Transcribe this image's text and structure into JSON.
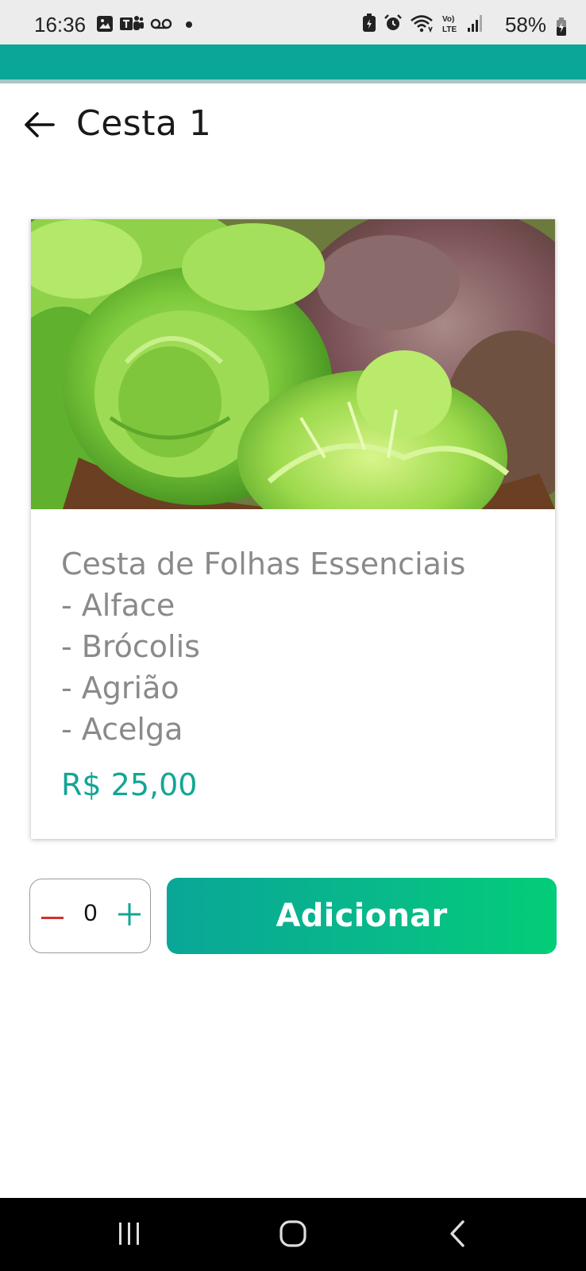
{
  "status_bar": {
    "time": "16:36",
    "battery_percent": "58%",
    "left_icons": [
      "image-icon",
      "teams-icon",
      "voicemail-icon",
      "dot-icon"
    ],
    "right_icons": [
      "battery-saver-icon",
      "alarm-icon",
      "wifi-icon",
      "volte-icon",
      "signal-icon",
      "battery-icon"
    ]
  },
  "header": {
    "title": "Cesta 1",
    "back_icon": "arrow-left-icon"
  },
  "product": {
    "image_alt": "lettuce-photo",
    "description_lines": [
      "Cesta de Folhas Essenciais",
      "- Alface",
      "- Brócolis",
      "- Agrião",
      "- Acelga"
    ],
    "price": "R$ 25,00"
  },
  "quantity": {
    "value": "0"
  },
  "actions": {
    "add_label": "Adicionar"
  },
  "colors": {
    "teal": "#0aa697",
    "green": "#03cd78",
    "price": "#14a594",
    "minus": "#d0322b"
  }
}
